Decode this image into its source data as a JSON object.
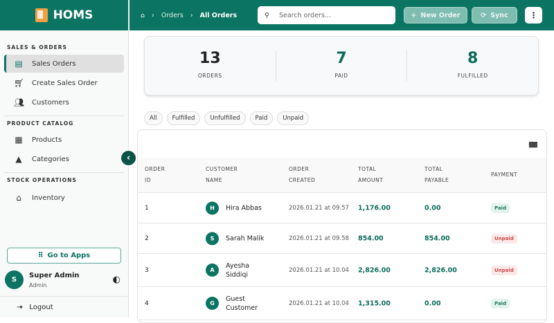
{
  "app": {
    "name": "HOMS"
  },
  "sidebar": {
    "sections": [
      {
        "title": "SALES & ORDERS",
        "items": [
          {
            "label": "Sales Orders",
            "icon": "list-icon",
            "active": true
          },
          {
            "label": "Create Sales Order",
            "icon": "cart-plus-icon"
          },
          {
            "label": "Customers",
            "icon": "people-icon"
          }
        ]
      },
      {
        "title": "PRODUCT CATALOG",
        "items": [
          {
            "label": "Products",
            "icon": "archive-icon"
          },
          {
            "label": "Categories",
            "icon": "shapes-icon"
          }
        ]
      },
      {
        "title": "STOCK OPERATIONS",
        "items": [
          {
            "label": "Inventory",
            "icon": "warehouse-icon"
          }
        ]
      }
    ],
    "go_to_apps": "Go to Apps",
    "user": {
      "initial": "S",
      "name": "Super Admin",
      "role": "Admin"
    },
    "logout": "Logout"
  },
  "header": {
    "breadcrumb": [
      "Orders",
      "All Orders"
    ],
    "search_placeholder": "Search orders...",
    "new_order": "New Order",
    "sync": "Sync"
  },
  "stats": [
    {
      "value": "13",
      "label": "ORDERS",
      "color": "#222222"
    },
    {
      "value": "7",
      "label": "PAID",
      "color": "#0b6b58"
    },
    {
      "value": "8",
      "label": "FULFILLED",
      "color": "#0b6b58"
    }
  ],
  "filters": [
    "All",
    "Fulfilled",
    "Unfulfilled",
    "Paid",
    "Unpaid"
  ],
  "table": {
    "headers": [
      [
        "ORDER",
        "ID"
      ],
      [
        "CUSTOMER",
        "NAME"
      ],
      [
        "ORDER",
        "CREATED"
      ],
      [
        "TOTAL",
        "AMOUNT"
      ],
      [
        "TOTAL",
        "PAYABLE"
      ],
      [
        "PAYMENT"
      ]
    ],
    "rows": [
      {
        "id": "1",
        "initial": "H",
        "name": [
          "Hira Abbas"
        ],
        "created": "2026.01.21 at 09.57",
        "amount": "1,176.00",
        "payable": "0.00",
        "payment": "Paid"
      },
      {
        "id": "2",
        "initial": "S",
        "name": [
          "Sarah Malik"
        ],
        "created": "2026.01.21 at 09.58",
        "amount": "854.00",
        "payable": "854.00",
        "payment": "Unpaid"
      },
      {
        "id": "3",
        "initial": "A",
        "name": [
          "Ayesha",
          "Siddiqi"
        ],
        "created": "2026.01.21 at 10.04",
        "amount": "2,826.00",
        "payable": "2,826.00",
        "payment": "Unpaid"
      },
      {
        "id": "4",
        "initial": "G",
        "name": [
          "Guest",
          "Customer"
        ],
        "created": "2026.01.21 at 10.04",
        "amount": "1,315.00",
        "payable": "0.00",
        "payment": "Paid"
      }
    ]
  },
  "colors": {
    "brand": "#0b7462",
    "paid": "#1f7a60",
    "unpaid": "#c94848"
  }
}
